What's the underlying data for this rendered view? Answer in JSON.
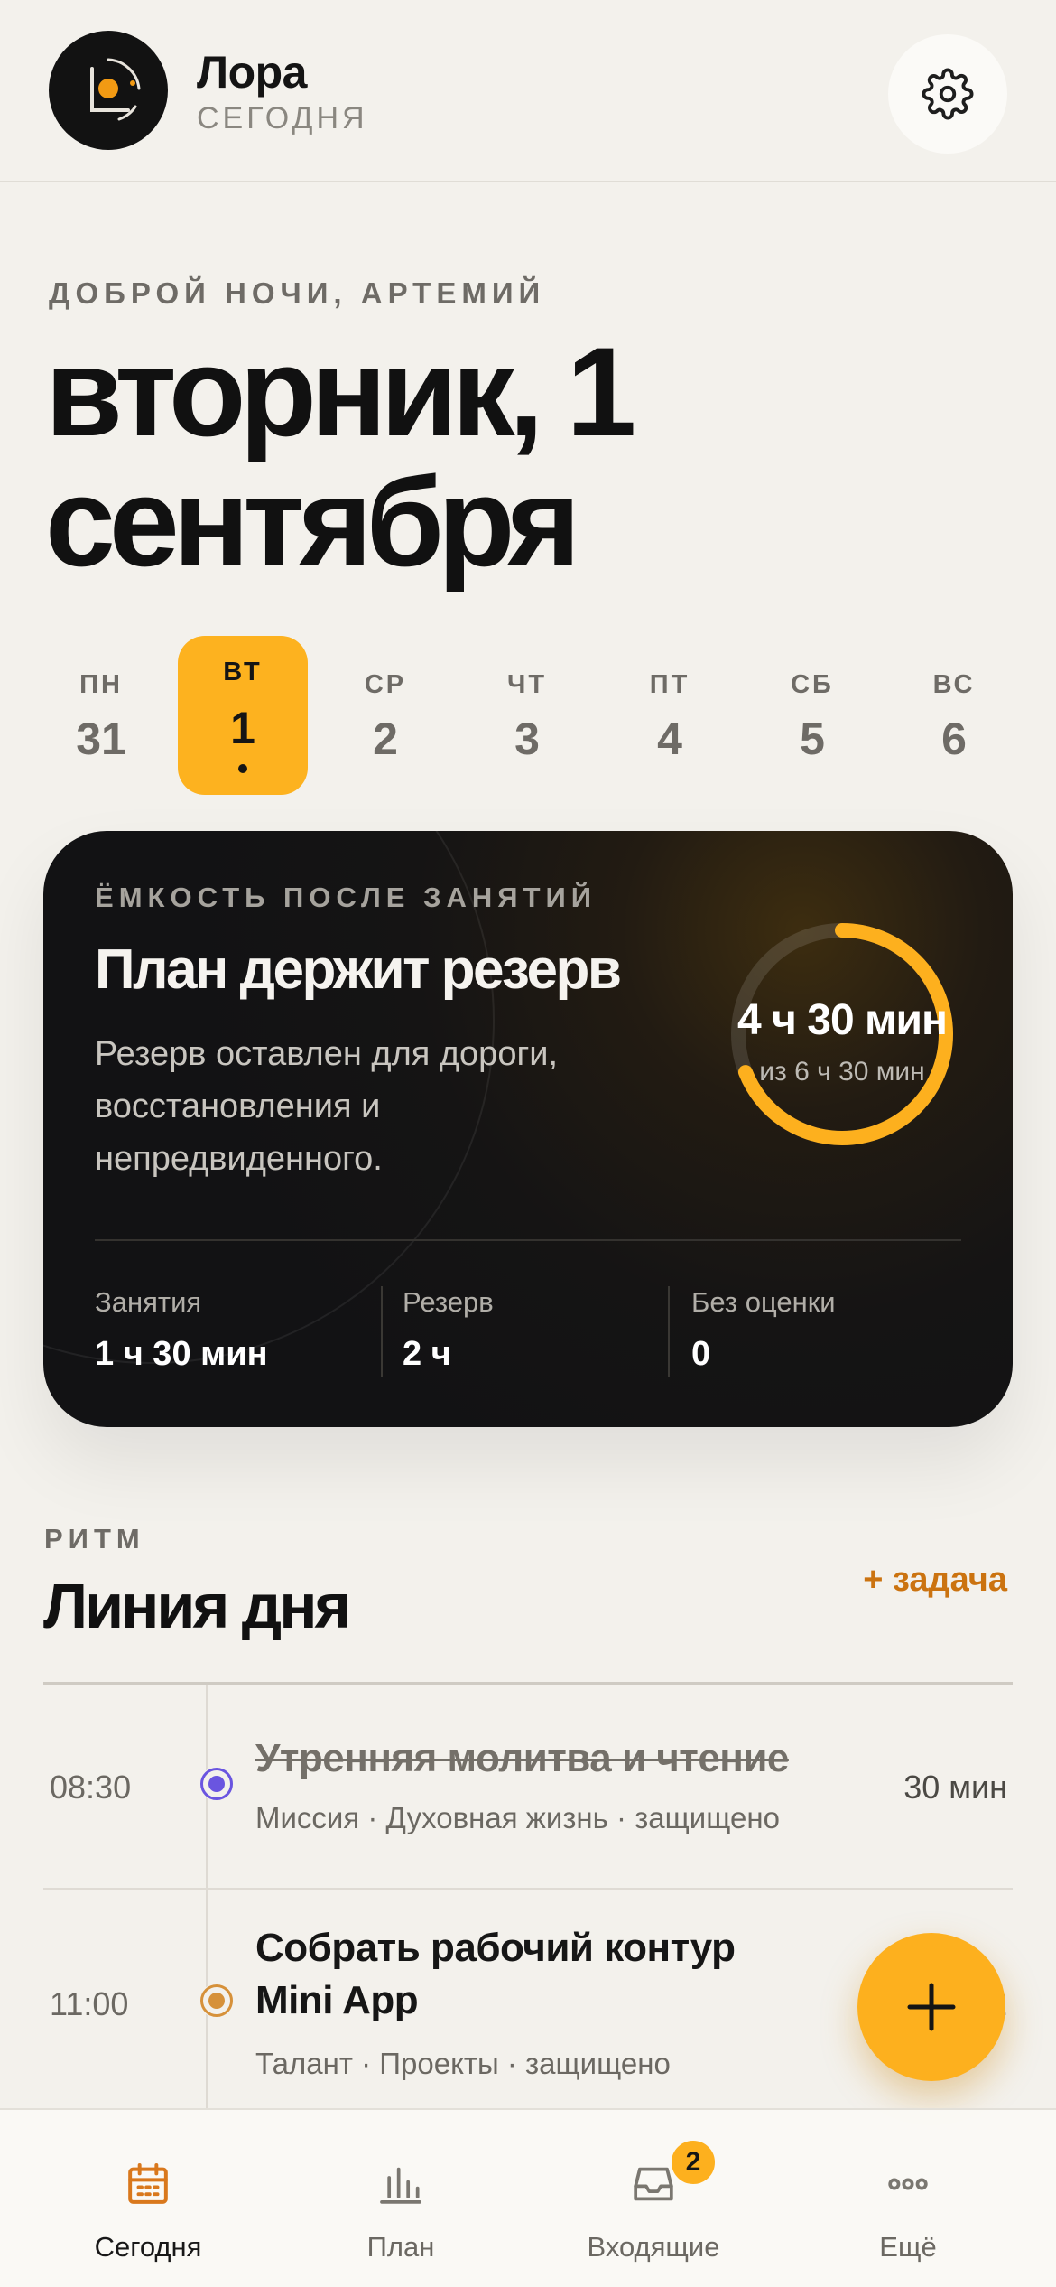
{
  "header": {
    "app_name": "Лора",
    "subtitle": "СЕГОДНЯ",
    "logo_icon": "orbit-logo-icon",
    "settings_icon": "gear-icon"
  },
  "greeting": "ДОБРОЙ НОЧИ, АРТЕМИЙ",
  "date_title": "вторник, 1 сентября",
  "week": [
    {
      "name": "ПН",
      "num": "31",
      "active": false
    },
    {
      "name": "ВТ",
      "num": "1",
      "active": true
    },
    {
      "name": "СР",
      "num": "2",
      "active": false
    },
    {
      "name": "ЧТ",
      "num": "3",
      "active": false
    },
    {
      "name": "ПТ",
      "num": "4",
      "active": false
    },
    {
      "name": "СБ",
      "num": "5",
      "active": false
    },
    {
      "name": "ВС",
      "num": "6",
      "active": false
    }
  ],
  "capacity": {
    "label": "ЁМКОСТЬ ПОСЛЕ ЗАНЯТИЙ",
    "title": "План держит резерв",
    "description": "Резерв оставлен для дороги, восстановления и непредвиденного.",
    "ring_value": "4 ч 30 мин",
    "ring_sub": "из 6 ч 30 мин",
    "ring_fraction": 0.69,
    "stats": [
      {
        "label": "Занятия",
        "value": "1 ч 30 мин"
      },
      {
        "label": "Резерв",
        "value": "2 ч"
      },
      {
        "label": "Без оценки",
        "value": "0"
      }
    ]
  },
  "rhythm": {
    "kicker": "РИТМ",
    "title": "Линия дня",
    "add_task": "+ задача",
    "items": [
      {
        "time": "08:30",
        "title": "Утренняя молитва и чтение",
        "meta": "Миссия · Духовная жизнь · защищено",
        "duration": "30 мин",
        "done": true
      },
      {
        "time": "11:00",
        "title_line1": "Собрать рабочий контур",
        "title_line2": "Mini App",
        "meta": "Талант · Проекты · защищено",
        "duration": "2",
        "done": false
      }
    ]
  },
  "fab_icon": "plus-icon",
  "nav": [
    {
      "label": "Сегодня",
      "icon": "calendar-icon",
      "active": true
    },
    {
      "label": "План",
      "icon": "bar-chart-icon",
      "active": false
    },
    {
      "label": "Входящие",
      "icon": "inbox-icon",
      "active": false,
      "badge": "2"
    },
    {
      "label": "Ещё",
      "icon": "more-icon",
      "active": false
    }
  ],
  "colors": {
    "background": "#f3f1ec",
    "accent": "#fdb01e",
    "accent_text": "#cb7310",
    "card": "#121214",
    "mission_dot": "#6a55e0",
    "talent_dot": "#d6913a"
  }
}
